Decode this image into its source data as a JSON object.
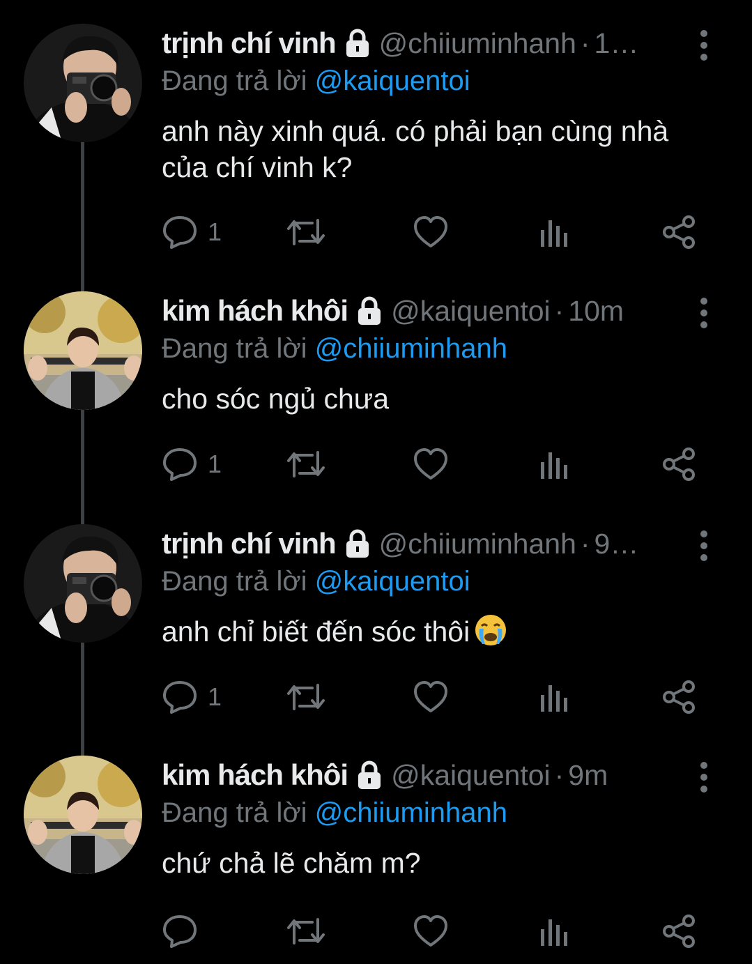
{
  "reply_prefix": "Đang trả lời ",
  "tweets": [
    {
      "name": "trịnh chí vinh",
      "handle": "@chiiuminhanh",
      "time": "1…",
      "reply_to": "@kaiquentoi",
      "text": "anh này xinh quá. có phải bạn cùng nhà của chí vinh k?",
      "reply_count": "1",
      "avatar": "camera-person-avatar"
    },
    {
      "name": "kim hách khôi",
      "handle": "@kaiquentoi",
      "time": "10m",
      "reply_to": "@chiiuminhanh",
      "text": "cho sóc ngủ chưa",
      "reply_count": "1",
      "avatar": "park-person-avatar"
    },
    {
      "name": "trịnh chí vinh",
      "handle": "@chiiuminhanh",
      "time": "9…",
      "reply_to": "@kaiquentoi",
      "text": "anh chỉ biết đến sóc thôi",
      "emoji": "loudly-crying-face",
      "reply_count": "1",
      "avatar": "camera-person-avatar"
    },
    {
      "name": "kim hách khôi",
      "handle": "@kaiquentoi",
      "time": "9m",
      "reply_to": "@chiiuminhanh",
      "text": "chứ chả lẽ chăm m?",
      "reply_count": "",
      "avatar": "park-person-avatar"
    }
  ],
  "colors": {
    "background": "#000000",
    "text": "#e7e9ea",
    "muted": "#71767b",
    "mention": "#1d9bf0",
    "thread_line": "#3e4144"
  },
  "icons": [
    "lock-icon",
    "more-icon",
    "reply-icon",
    "retweet-icon",
    "like-icon",
    "views-icon",
    "share-icon"
  ]
}
